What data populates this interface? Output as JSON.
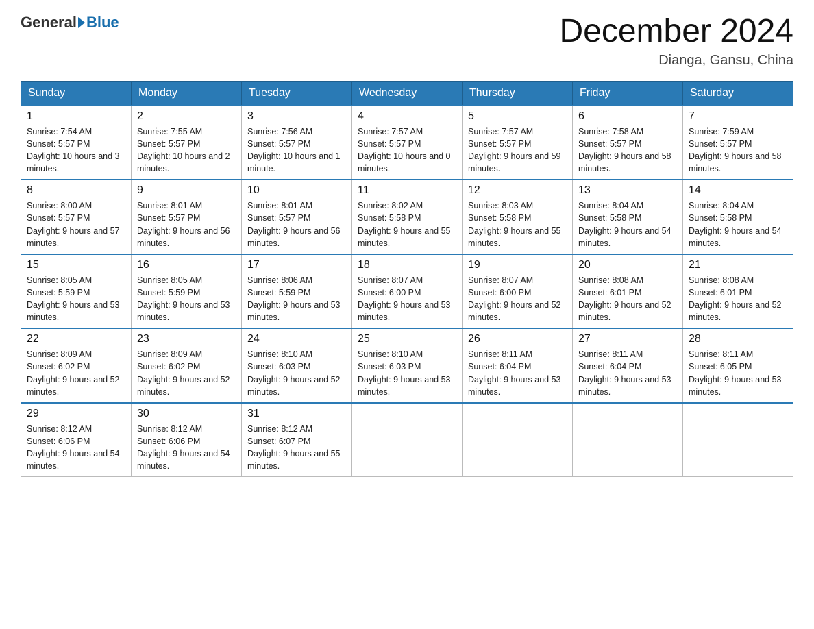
{
  "header": {
    "logo_general": "General",
    "logo_blue": "Blue",
    "month_title": "December 2024",
    "location": "Dianga, Gansu, China"
  },
  "days_of_week": [
    "Sunday",
    "Monday",
    "Tuesday",
    "Wednesday",
    "Thursday",
    "Friday",
    "Saturday"
  ],
  "weeks": [
    [
      {
        "day": "1",
        "sunrise": "7:54 AM",
        "sunset": "5:57 PM",
        "daylight": "10 hours and 3 minutes."
      },
      {
        "day": "2",
        "sunrise": "7:55 AM",
        "sunset": "5:57 PM",
        "daylight": "10 hours and 2 minutes."
      },
      {
        "day": "3",
        "sunrise": "7:56 AM",
        "sunset": "5:57 PM",
        "daylight": "10 hours and 1 minute."
      },
      {
        "day": "4",
        "sunrise": "7:57 AM",
        "sunset": "5:57 PM",
        "daylight": "10 hours and 0 minutes."
      },
      {
        "day": "5",
        "sunrise": "7:57 AM",
        "sunset": "5:57 PM",
        "daylight": "9 hours and 59 minutes."
      },
      {
        "day": "6",
        "sunrise": "7:58 AM",
        "sunset": "5:57 PM",
        "daylight": "9 hours and 58 minutes."
      },
      {
        "day": "7",
        "sunrise": "7:59 AM",
        "sunset": "5:57 PM",
        "daylight": "9 hours and 58 minutes."
      }
    ],
    [
      {
        "day": "8",
        "sunrise": "8:00 AM",
        "sunset": "5:57 PM",
        "daylight": "9 hours and 57 minutes."
      },
      {
        "day": "9",
        "sunrise": "8:01 AM",
        "sunset": "5:57 PM",
        "daylight": "9 hours and 56 minutes."
      },
      {
        "day": "10",
        "sunrise": "8:01 AM",
        "sunset": "5:57 PM",
        "daylight": "9 hours and 56 minutes."
      },
      {
        "day": "11",
        "sunrise": "8:02 AM",
        "sunset": "5:58 PM",
        "daylight": "9 hours and 55 minutes."
      },
      {
        "day": "12",
        "sunrise": "8:03 AM",
        "sunset": "5:58 PM",
        "daylight": "9 hours and 55 minutes."
      },
      {
        "day": "13",
        "sunrise": "8:04 AM",
        "sunset": "5:58 PM",
        "daylight": "9 hours and 54 minutes."
      },
      {
        "day": "14",
        "sunrise": "8:04 AM",
        "sunset": "5:58 PM",
        "daylight": "9 hours and 54 minutes."
      }
    ],
    [
      {
        "day": "15",
        "sunrise": "8:05 AM",
        "sunset": "5:59 PM",
        "daylight": "9 hours and 53 minutes."
      },
      {
        "day": "16",
        "sunrise": "8:05 AM",
        "sunset": "5:59 PM",
        "daylight": "9 hours and 53 minutes."
      },
      {
        "day": "17",
        "sunrise": "8:06 AM",
        "sunset": "5:59 PM",
        "daylight": "9 hours and 53 minutes."
      },
      {
        "day": "18",
        "sunrise": "8:07 AM",
        "sunset": "6:00 PM",
        "daylight": "9 hours and 53 minutes."
      },
      {
        "day": "19",
        "sunrise": "8:07 AM",
        "sunset": "6:00 PM",
        "daylight": "9 hours and 52 minutes."
      },
      {
        "day": "20",
        "sunrise": "8:08 AM",
        "sunset": "6:01 PM",
        "daylight": "9 hours and 52 minutes."
      },
      {
        "day": "21",
        "sunrise": "8:08 AM",
        "sunset": "6:01 PM",
        "daylight": "9 hours and 52 minutes."
      }
    ],
    [
      {
        "day": "22",
        "sunrise": "8:09 AM",
        "sunset": "6:02 PM",
        "daylight": "9 hours and 52 minutes."
      },
      {
        "day": "23",
        "sunrise": "8:09 AM",
        "sunset": "6:02 PM",
        "daylight": "9 hours and 52 minutes."
      },
      {
        "day": "24",
        "sunrise": "8:10 AM",
        "sunset": "6:03 PM",
        "daylight": "9 hours and 52 minutes."
      },
      {
        "day": "25",
        "sunrise": "8:10 AM",
        "sunset": "6:03 PM",
        "daylight": "9 hours and 53 minutes."
      },
      {
        "day": "26",
        "sunrise": "8:11 AM",
        "sunset": "6:04 PM",
        "daylight": "9 hours and 53 minutes."
      },
      {
        "day": "27",
        "sunrise": "8:11 AM",
        "sunset": "6:04 PM",
        "daylight": "9 hours and 53 minutes."
      },
      {
        "day": "28",
        "sunrise": "8:11 AM",
        "sunset": "6:05 PM",
        "daylight": "9 hours and 53 minutes."
      }
    ],
    [
      {
        "day": "29",
        "sunrise": "8:12 AM",
        "sunset": "6:06 PM",
        "daylight": "9 hours and 54 minutes."
      },
      {
        "day": "30",
        "sunrise": "8:12 AM",
        "sunset": "6:06 PM",
        "daylight": "9 hours and 54 minutes."
      },
      {
        "day": "31",
        "sunrise": "8:12 AM",
        "sunset": "6:07 PM",
        "daylight": "9 hours and 55 minutes."
      },
      null,
      null,
      null,
      null
    ]
  ]
}
